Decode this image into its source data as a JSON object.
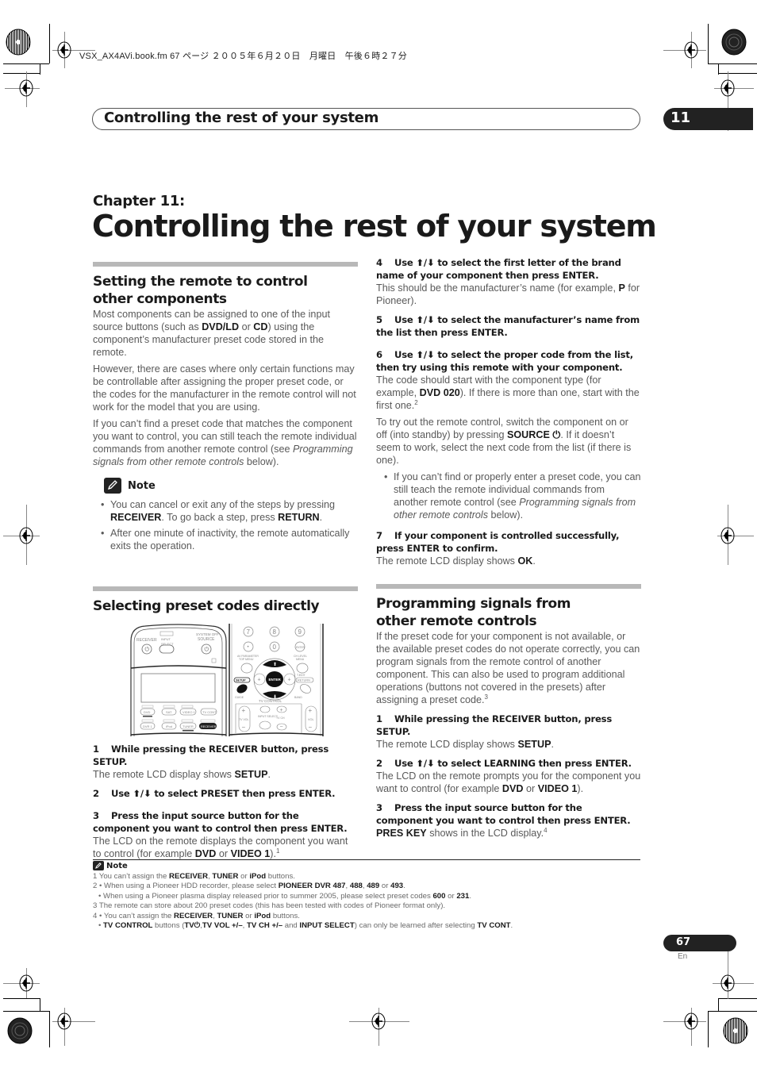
{
  "file_meta": "VSX_AX4AVi.book.fm  67 ページ  ２００５年６月２０日　月曜日　午後６時２７分",
  "header": {
    "running_title": "Controlling the rest of your system",
    "chapter_number": "11"
  },
  "chapter": {
    "label": "Chapter 11:",
    "title": "Controlling the rest of your system"
  },
  "left": {
    "section1": {
      "title": "Setting the remote to control other components",
      "paragraphs": [
        {
          "pre": "Most components can be assigned to one of the input source buttons (such as ",
          "b1": "DVD/LD",
          "mid": " or ",
          "b2": "CD",
          "post": ") using the component’s manufacturer preset code stored in the remote."
        },
        {
          "text": "However, there are cases where only certain functions may be controllable after assigning the proper preset code, or the codes for the manufacturer in the remote control will not work for the model that you are using."
        },
        {
          "pre": "If you can’t find a preset code that matches the component you want to control, you can still teach the remote individual commands from another remote control (see ",
          "italic": "Programming signals from other remote controls",
          "post": " below)."
        }
      ],
      "note": {
        "label": "Note",
        "bullets": [
          {
            "pre": "You can cancel or exit any of the steps by pressing ",
            "b1": "RECEIVER",
            "mid": ". To go back a step, press ",
            "b2": "RETURN",
            "post": "."
          },
          {
            "text": "After one minute of inactivity, the remote automatically exits the operation."
          }
        ]
      }
    },
    "section2": {
      "title": "Selecting preset codes directly",
      "figure": {
        "labels": {
          "receiver": "RECEIVER",
          "input": "INPUT",
          "select": "SELECT",
          "system_off": "SYSTEM OFF",
          "source": "SOURCE",
          "dvd": "DVD",
          "sat": "SAT",
          "video1": "VIDEO 1",
          "tv_cont": "TV CONT",
          "dvr1": "DVR 1",
          "ipod": "iPod",
          "tuner": "TUNER",
          "receiver_btn": "RECEIVER",
          "n7": "7",
          "n8": "8",
          "n9": "9",
          "n0": "0",
          "dot": "•",
          "enter_small": "ENTER",
          "enter": "ENTER",
          "setup": "SETUP",
          "guide": "GUIDE",
          "band": "BAND",
          "return": "RETURN",
          "tv_control": "TV CONTROL",
          "tv_vol": "TV VOL",
          "input_select": "INPUT SELECT",
          "tv_ch": "TV CH",
          "vol": "VOL",
          "av_parameter": "AV PARAMETER",
          "top_menu": "TOP MENU",
          "ch_level": "CH LEVEL",
          "menu": "MENU",
          "t_edit": "T.EDIT"
        }
      },
      "steps": [
        {
          "num": "1",
          "title": "While pressing the RECEIVER button, press SETUP.",
          "body_pre": "The remote LCD display shows ",
          "body_b": "SETUP",
          "body_post": "."
        },
        {
          "num": "2",
          "title_pre": "Use ",
          "arrows": "⬆/⬇",
          "title_post": " to select PRESET then press ENTER."
        },
        {
          "num": "3",
          "title": "Press the input source button for the component you want to control then press ENTER.",
          "body_pre": "The LCD on the remote displays the component you want to control (for example ",
          "b1": "DVD",
          "mid": " or ",
          "b2": "VIDEO 1",
          "body_post": ").",
          "sup": "1"
        }
      ]
    }
  },
  "right": {
    "steps": [
      {
        "num": "4",
        "title_pre": "Use ",
        "arrows": "⬆/⬇",
        "title_post": " to select the first letter of the brand name of your component then press ENTER.",
        "body_pre": "This should be the manufacturer’s name (for example, ",
        "body_b": "P",
        "body_post": " for Pioneer)."
      },
      {
        "num": "5",
        "title_pre": "Use ",
        "arrows": "⬆/⬇",
        "title_post": " to select the manufacturer’s name from the list then press ENTER."
      },
      {
        "num": "6",
        "title_pre": "Use ",
        "arrows": "⬆/⬇",
        "title_post": " to select the proper code from the list, then try using this remote with your component.",
        "body_pre": "The code should start with the component type (for example, ",
        "body_b": "DVD 020",
        "body_post": "). If there is more than one, start with the first one.",
        "sup": "2"
      }
    ],
    "tryout": {
      "pre": "To try out the remote control, switch the component on or off (into standby) by pressing ",
      "b": "SOURCE ⏻",
      "post": ". If it doesn’t seem to work, select the next code from the list (if there is one)."
    },
    "bullet": {
      "pre": "If you can’t find or properly enter a preset code, you can still teach the remote individual commands from another remote control (see ",
      "italic": "Programming signals from other remote controls",
      "post": " below)."
    },
    "step7": {
      "num": "7",
      "title": "If your component is controlled successfully, press ENTER to confirm.",
      "body_pre": "The remote LCD display shows ",
      "body_b": "OK",
      "body_post": "."
    },
    "section3": {
      "title": "Programming signals from other remote controls",
      "intro": "If the preset code for your component is not available, or the available preset codes do not operate correctly, you can program signals from the remote control of another component. This can also be used to program additional operations (buttons not covered in the presets) after assigning a preset code.",
      "intro_sup": "3",
      "steps": [
        {
          "num": "1",
          "title": "While pressing the RECEIVER button, press SETUP.",
          "body_pre": "The remote LCD display shows ",
          "body_b": "SETUP",
          "body_post": "."
        },
        {
          "num": "2",
          "title_pre": "Use ",
          "arrows": "⬆/⬇",
          "title_post": " to select LEARNING then press ENTER.",
          "body_pre": "The LCD on the remote prompts you for the component you want to control (for example ",
          "b1": "DVD",
          "mid": " or ",
          "b2": "VIDEO 1",
          "body_post": ")."
        },
        {
          "num": "3",
          "title": "Press the input source button for the component you want to control then press ENTER.",
          "body_b": "PRES KEY",
          "body_post": " shows in the LCD display.",
          "sup": "4"
        }
      ]
    }
  },
  "footnotes": {
    "label": "Note",
    "items": [
      {
        "prefix": "1 ",
        "parts": [
          [
            "t",
            "You can’t assign the "
          ],
          [
            "b",
            "RECEIVER"
          ],
          [
            "t",
            ", "
          ],
          [
            "b",
            "TUNER"
          ],
          [
            "t",
            " or "
          ],
          [
            "b",
            "iPod"
          ],
          [
            "t",
            " buttons."
          ]
        ]
      },
      {
        "prefix": "2 • ",
        "parts": [
          [
            "t",
            "When using a Pioneer HDD recorder, please select "
          ],
          [
            "b",
            "PIONEER DVR 487"
          ],
          [
            "t",
            ", "
          ],
          [
            "b",
            "488"
          ],
          [
            "t",
            ", "
          ],
          [
            "b",
            "489"
          ],
          [
            "t",
            " or "
          ],
          [
            "b",
            "493"
          ],
          [
            "t",
            "."
          ]
        ]
      },
      {
        "prefix": "• ",
        "sub": true,
        "parts": [
          [
            "t",
            "When using a Pioneer plasma display released prior to summer 2005, please select preset codes "
          ],
          [
            "b",
            "600"
          ],
          [
            "t",
            " or "
          ],
          [
            "b",
            "231"
          ],
          [
            "t",
            "."
          ]
        ]
      },
      {
        "prefix": "3  ",
        "parts": [
          [
            "t",
            "The remote can store about 200 preset codes (this has been tested with codes of Pioneer format only)."
          ]
        ]
      },
      {
        "prefix": "4 • ",
        "parts": [
          [
            "t",
            "You can’t assign the "
          ],
          [
            "b",
            "RECEIVER"
          ],
          [
            "t",
            ", "
          ],
          [
            "b",
            "TUNER"
          ],
          [
            "t",
            " or "
          ],
          [
            "b",
            "iPod"
          ],
          [
            "t",
            " buttons."
          ]
        ]
      },
      {
        "prefix": "• ",
        "sub": true,
        "parts": [
          [
            "b",
            "TV CONTROL"
          ],
          [
            "t",
            " buttons ("
          ],
          [
            "b",
            "TV⏻"
          ],
          [
            "t",
            ","
          ],
          [
            "b",
            "TV VOL +/–"
          ],
          [
            "t",
            ", "
          ],
          [
            "b",
            "TV CH +/–"
          ],
          [
            "t",
            " and "
          ],
          [
            "b",
            "INPUT SELECT"
          ],
          [
            "t",
            ") can only be learned after selecting "
          ],
          [
            "b",
            "TV CONT"
          ],
          [
            "t",
            "."
          ]
        ]
      }
    ]
  },
  "page": {
    "number": "67",
    "lang": "En"
  }
}
